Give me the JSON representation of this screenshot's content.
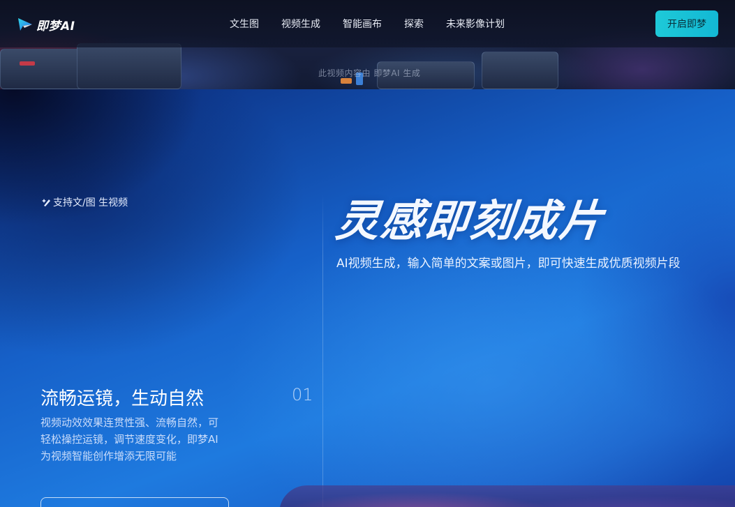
{
  "nav": {
    "logo_text": "即梦AI",
    "links": [
      "文生图",
      "视频生成",
      "智能画布",
      "探索",
      "未来影像计划"
    ],
    "cta_label": "开启即梦"
  },
  "hero": {
    "caption": "此视频内容由 即梦AI 生成"
  },
  "main": {
    "support_tag": "支持文/图 生视频",
    "headline": "灵感即刻成片",
    "subheadline": "AI视频生成，输入简单的文案或图片，即可快速生成优质视频片段",
    "feature": {
      "title": "流畅运镜，生动自然",
      "index": "01",
      "description": "视频动效效果连贯性强、流畅自然，可轻松操控运镜，调节速度变化，即梦AI为视频智能创作增添无限可能"
    }
  },
  "colors": {
    "cta": "#1ec9d8",
    "accent_blue": "#1e7adf"
  },
  "icons": {
    "logo": "logo-mark-icon",
    "support": "sparkle-pen-icon"
  }
}
